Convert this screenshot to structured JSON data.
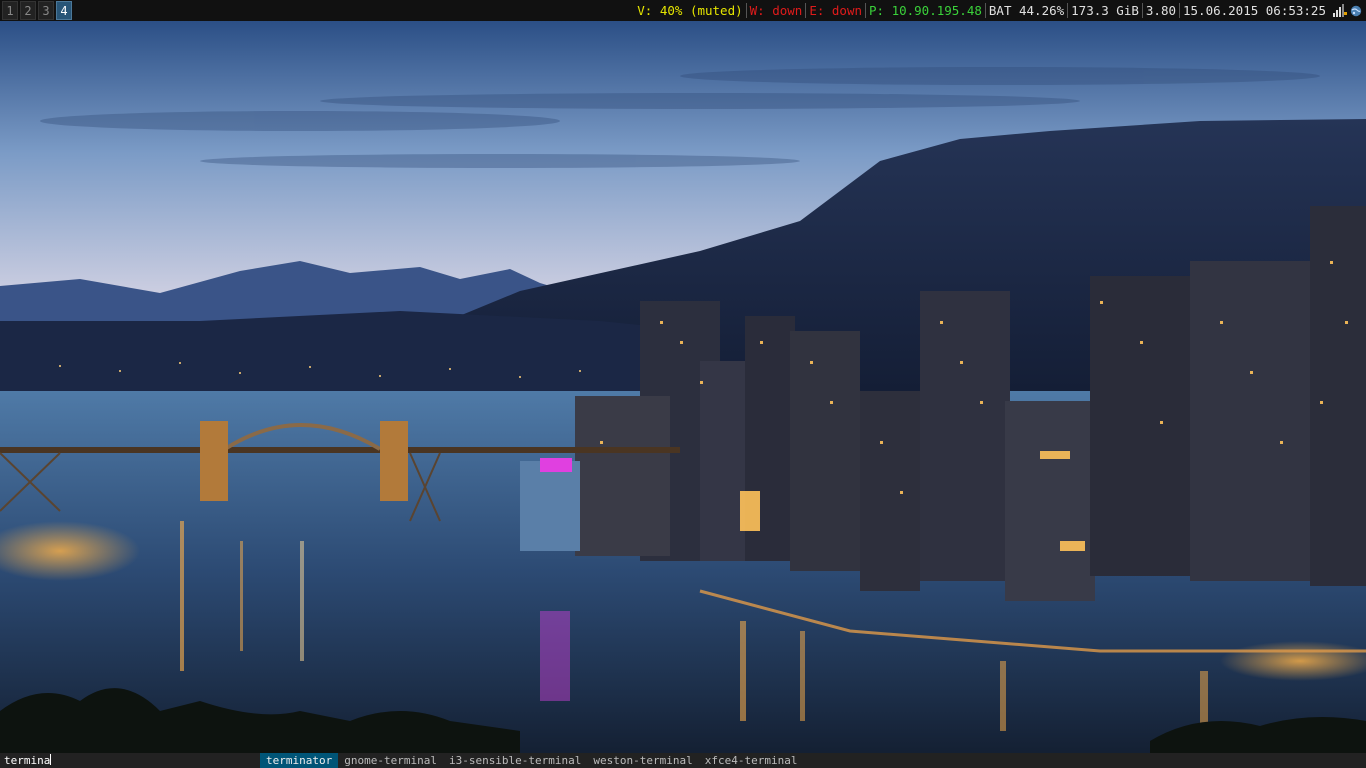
{
  "bar": {
    "workspaces": [
      "1",
      "2",
      "3",
      "4"
    ],
    "active_workspace": "4",
    "volume": "V: 40% (muted)",
    "wifi": "W: down",
    "ethernet": "E: down",
    "vpn": "P: 10.90.195.48",
    "battery": "BAT 44.26%",
    "disk": "173.3 GiB",
    "load": "3.80",
    "datetime": "15.06.2015 06:53:25",
    "colors": {
      "volume": "#e5e500",
      "down": "#e01b1b",
      "up": "#3ad13a",
      "normal": "#e0e0e0"
    },
    "tray": [
      "network-signal-icon",
      "app-globe-icon"
    ]
  },
  "wallpaper": {
    "subject": "city-skyline-at-dusk"
  },
  "dmenu": {
    "input": "termina",
    "items": [
      "terminator",
      "gnome-terminal",
      "i3-sensible-terminal",
      "weston-terminal",
      "xfce4-terminal"
    ],
    "selected": "terminator"
  }
}
